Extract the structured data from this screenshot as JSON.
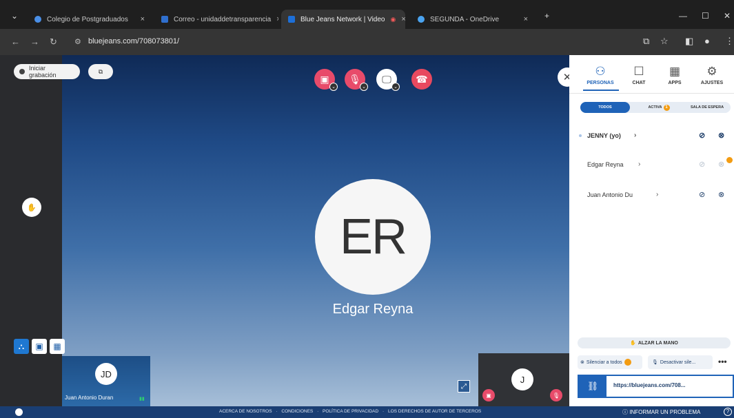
{
  "browser": {
    "tabs": [
      {
        "title": "Colegio de Postgraduados",
        "close": "×",
        "color": "#4a8fe7"
      },
      {
        "title": "Correo - unidaddetransparencia",
        "close": "×",
        "color": "#2f6fce"
      },
      {
        "title": "Blue Jeans Network | Video",
        "close": "×",
        "color": "#1d6fd8"
      },
      {
        "title": "SEGUNDA - OneDrive",
        "close": "×",
        "color": "#4aa3f0"
      }
    ],
    "new_tab": "+",
    "url_site": "",
    "url": "bluejeans.com/708073801/"
  },
  "meeting": {
    "record_label": "Iniciar grabación",
    "speaker_initials": "ER",
    "speaker_name": "Edgar Reyna",
    "thumb_jd_initials": "JD",
    "thumb_jd_name": "Juan Antonio Duran",
    "thumb_j_initials": "J"
  },
  "panel": {
    "tabs": [
      "PERSONAS",
      "CHAT",
      "APPS",
      "AJUSTES"
    ],
    "filters": [
      "TODOS",
      "ACTIVA",
      "SALA DE ESPERA"
    ],
    "filter_badge": "1",
    "people": [
      "JENNY (yo)",
      "Edgar Reyna",
      "Juan Antonio Du"
    ],
    "raise_hand": "ALZAR LA MANO",
    "mute_all": "Silenciar a todos",
    "disable_all": "Desactivar sile...",
    "more": "•••",
    "link": "https://bluejeans.com/708..."
  },
  "footer": {
    "links": [
      "ACERCA DE NOSOTROS",
      "·",
      "CONDICIONES",
      "·",
      "POLÍTICA DE PRIVACIDAD",
      "·",
      "LOS DERECHOS DE AUTOR DE TERCEROS"
    ],
    "report": "INFORMAR UN PROBLEMA",
    "help": "?"
  },
  "colors": {
    "accent": "#1f63b8",
    "end_call": "#e8495f",
    "muted": "#e84b6a"
  }
}
